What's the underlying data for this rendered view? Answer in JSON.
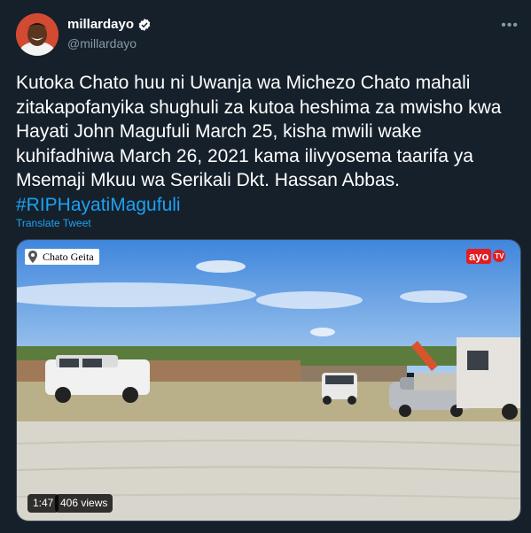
{
  "author": {
    "display_name": "millardayo",
    "handle": "@millardayo",
    "verified": true,
    "avatar": "avatar"
  },
  "tweet": {
    "text": "Kutoka Chato huu ni Uwanja wa Michezo Chato mahali zitakapofanyika shughuli za kutoa heshima za mwisho kwa Hayati John Magufuli March 25, kisha mwili wake kuhifadhiwa March 26, 2021 kama ilivyosema taarifa ya Msemaji Mkuu wa Serikali Dkt. Hassan Abbas.",
    "hashtag": "#RIPHayatiMagufuli",
    "translate_label": "Translate Tweet"
  },
  "media": {
    "location_label": "Chato Geita",
    "logo_text": "ayo",
    "logo_tv": "TV",
    "duration": "1:47",
    "views": "406 views"
  },
  "icons": {
    "more": "more-icon",
    "verified": "verified-icon",
    "pin": "pin-icon"
  },
  "colors": {
    "background": "#15202b",
    "link": "#1da1f2",
    "secondary_text": "#8899a6",
    "logo_red": "#e21d24"
  }
}
